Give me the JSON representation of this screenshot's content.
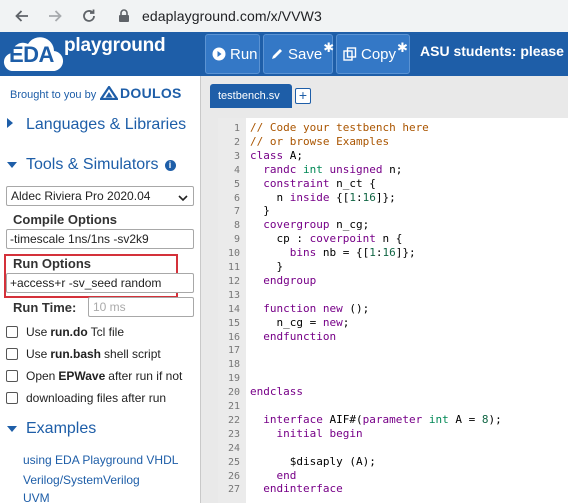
{
  "browser": {
    "url": "edaplayground.com/x/VVW3"
  },
  "header": {
    "logo_eda": "EDA",
    "logo_text": "playground",
    "run_label": "Run",
    "save_label": "Save",
    "copy_label": "Copy",
    "asu_text": "ASU students: please log"
  },
  "sidebar": {
    "brought_by": "Brought to you by",
    "sponsor": "DOULOS",
    "languages_label": "Languages & Libraries",
    "tools_label": "Tools & Simulators",
    "simulator": "Aldec Riviera Pro 2020.04",
    "compile_label": "Compile Options",
    "compile_value": "-timescale 1ns/1ns -sv2k9",
    "run_label": "Run Options",
    "run_value": "+access+r -sv_seed random",
    "runtime_label": "Run Time:",
    "runtime_placeholder": "10 ms",
    "checkboxes": [
      {
        "pre": "Use",
        "bold": "run.do",
        "post": "Tcl file"
      },
      {
        "pre": "Use",
        "bold": "run.bash",
        "post": "shell script"
      },
      {
        "pre": "Open",
        "bold": "EPWave",
        "post": "after run if not"
      },
      {
        "pre": "",
        "bold": "",
        "post": "downloading files after run"
      }
    ],
    "examples_label": "Examples",
    "example_links": [
      "using EDA Playground VHDL",
      "Verilog/SystemVerilog",
      "UVM"
    ]
  },
  "editor": {
    "tab_label": "testbench.sv",
    "lines": [
      {
        "n": "1",
        "t": "// Code your testbench here"
      },
      {
        "n": "2",
        "t": "// or browse Examples"
      },
      {
        "n": "3",
        "t": "class A;"
      },
      {
        "n": "4",
        "t": "  randc int unsigned n;"
      },
      {
        "n": "5",
        "t": "  constraint n_ct {"
      },
      {
        "n": "6",
        "t": "    n inside {[1:16]};"
      },
      {
        "n": "7",
        "t": "  }"
      },
      {
        "n": "8",
        "t": "  covergroup n_cg;"
      },
      {
        "n": "9",
        "t": "    cp : coverpoint n {"
      },
      {
        "n": "10",
        "t": "      bins nb = {[1:16]};"
      },
      {
        "n": "11",
        "t": "    }"
      },
      {
        "n": "12",
        "t": "  endgroup"
      },
      {
        "n": "13",
        "t": ""
      },
      {
        "n": "14",
        "t": "  function new ();"
      },
      {
        "n": "15",
        "t": "    n_cg = new;"
      },
      {
        "n": "16",
        "t": "  endfunction"
      },
      {
        "n": "17",
        "t": ""
      },
      {
        "n": "18",
        "t": ""
      },
      {
        "n": "19",
        "t": ""
      },
      {
        "n": "20",
        "t": "endclass"
      },
      {
        "n": "21",
        "t": ""
      },
      {
        "n": "22",
        "t": "  interface AIF#(parameter int A = 8);"
      },
      {
        "n": "23",
        "t": "    initial begin"
      },
      {
        "n": "24",
        "t": ""
      },
      {
        "n": "25",
        "t": "      $disaply (A);"
      },
      {
        "n": "26",
        "t": "    end"
      },
      {
        "n": "27",
        "t": "  endinterface"
      }
    ]
  },
  "colors": {
    "brand_blue": "#1e5ea8",
    "highlight_red": "#d4313a"
  }
}
